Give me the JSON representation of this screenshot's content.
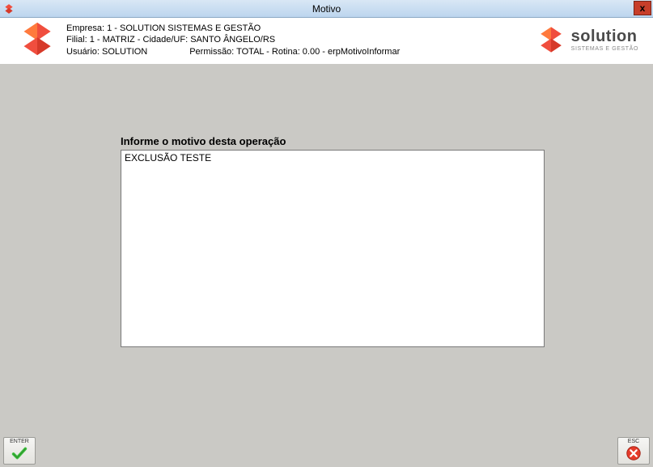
{
  "window": {
    "title": "Motivo",
    "close_label": "x"
  },
  "header": {
    "empresa": "Empresa: 1 - SOLUTION SISTEMAS E GESTÃO",
    "filial": "Filial: 1 - MATRIZ - Cidade/UF: SANTO ÂNGELO/RS",
    "usuario_label": "Usuário: SOLUTION",
    "permissao": "Permissão: TOTAL - Rotina: 0.00 - erpMotivoInformar",
    "brand_main": "solution",
    "brand_sub": "SISTEMAS E GESTÃO"
  },
  "form": {
    "prompt": "Informe o motivo desta operação",
    "reason_value": "EXCLUSÃO TESTE"
  },
  "footer": {
    "enter_label": "ENTER",
    "esc_label": "ESC"
  }
}
